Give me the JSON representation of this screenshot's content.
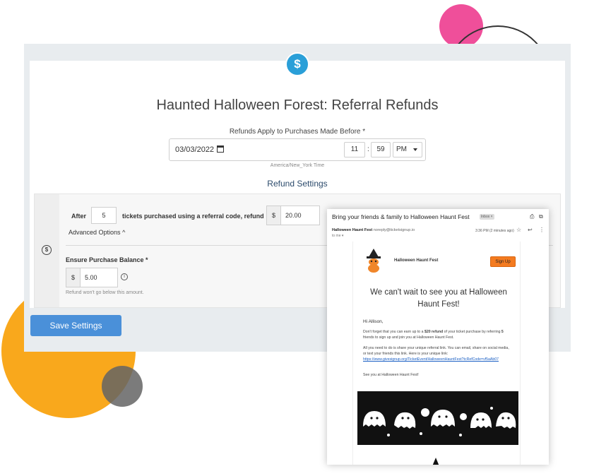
{
  "app": {
    "page_title": "Haunted Halloween Forest: Referral Refunds",
    "refund_date_label": "Refunds Apply to Purchases Made Before *",
    "date_value": "03/03/2022",
    "hour_value": "11",
    "minute_value": "59",
    "ampm_value": "PM",
    "timezone": "America/New_York Time",
    "section_title": "Refund Settings",
    "rule": {
      "after_label": "After",
      "tickets_count": "5",
      "tickets_label": "tickets purchased using a referral code, refund",
      "currency_symbol": "$",
      "refund_amount": "20.00"
    },
    "advanced_options_label": "Advanced Options",
    "balance": {
      "label": "Ensure Purchase Balance *",
      "currency_symbol": "$",
      "value": "5.00",
      "hint": "Refund won't go below this amount."
    },
    "save_label": "Save Settings"
  },
  "email": {
    "subject": "Bring your friends & family to Halloween Haunt Fest",
    "inbox_badge": "Inbox ×",
    "sender_name": "Halloween Haunt Fest",
    "sender_email": "noreply@ticketsignup.io",
    "to_me": "to me ▾",
    "time": "3:36 PM (2 minutes ago)",
    "brand_name": "Halloween Haunt Fest",
    "signup_label": "Sign Up",
    "headline": "We can't wait to see you at Halloween Haunt Fest!",
    "greeting": "Hi Allison,",
    "para1_pre": "Don't forget that you can earn up to a ",
    "para1_bold1": "$20 refund",
    "para1_mid": " of your ticket purchase by referring ",
    "para1_bold2": "5",
    "para1_post": " friends to sign up and join you at Halloween Haunt Fest.",
    "para2_pre": "All you need to do is share your unique referral link. You can email, share on social media, or text your friends this link. Here is your unique link: ",
    "referral_link": "https://www.givesignup.org/TicketEvent/HalloweenHauntFest?tcRefCode=vf5aAb07",
    "signoff": "See you at Halloween Haunt Fest!"
  },
  "colors": {
    "accent_blue": "#4a90d9",
    "icon_blue": "#2a9fd8",
    "signup_orange": "#f47b20",
    "deco_pink": "#ef4f9a",
    "deco_yellow": "#f9a81c"
  },
  "icons": {
    "top": "refund-icon",
    "gutter": "dollar-icon",
    "info": "info-icon",
    "calendar": "calendar-icon"
  }
}
